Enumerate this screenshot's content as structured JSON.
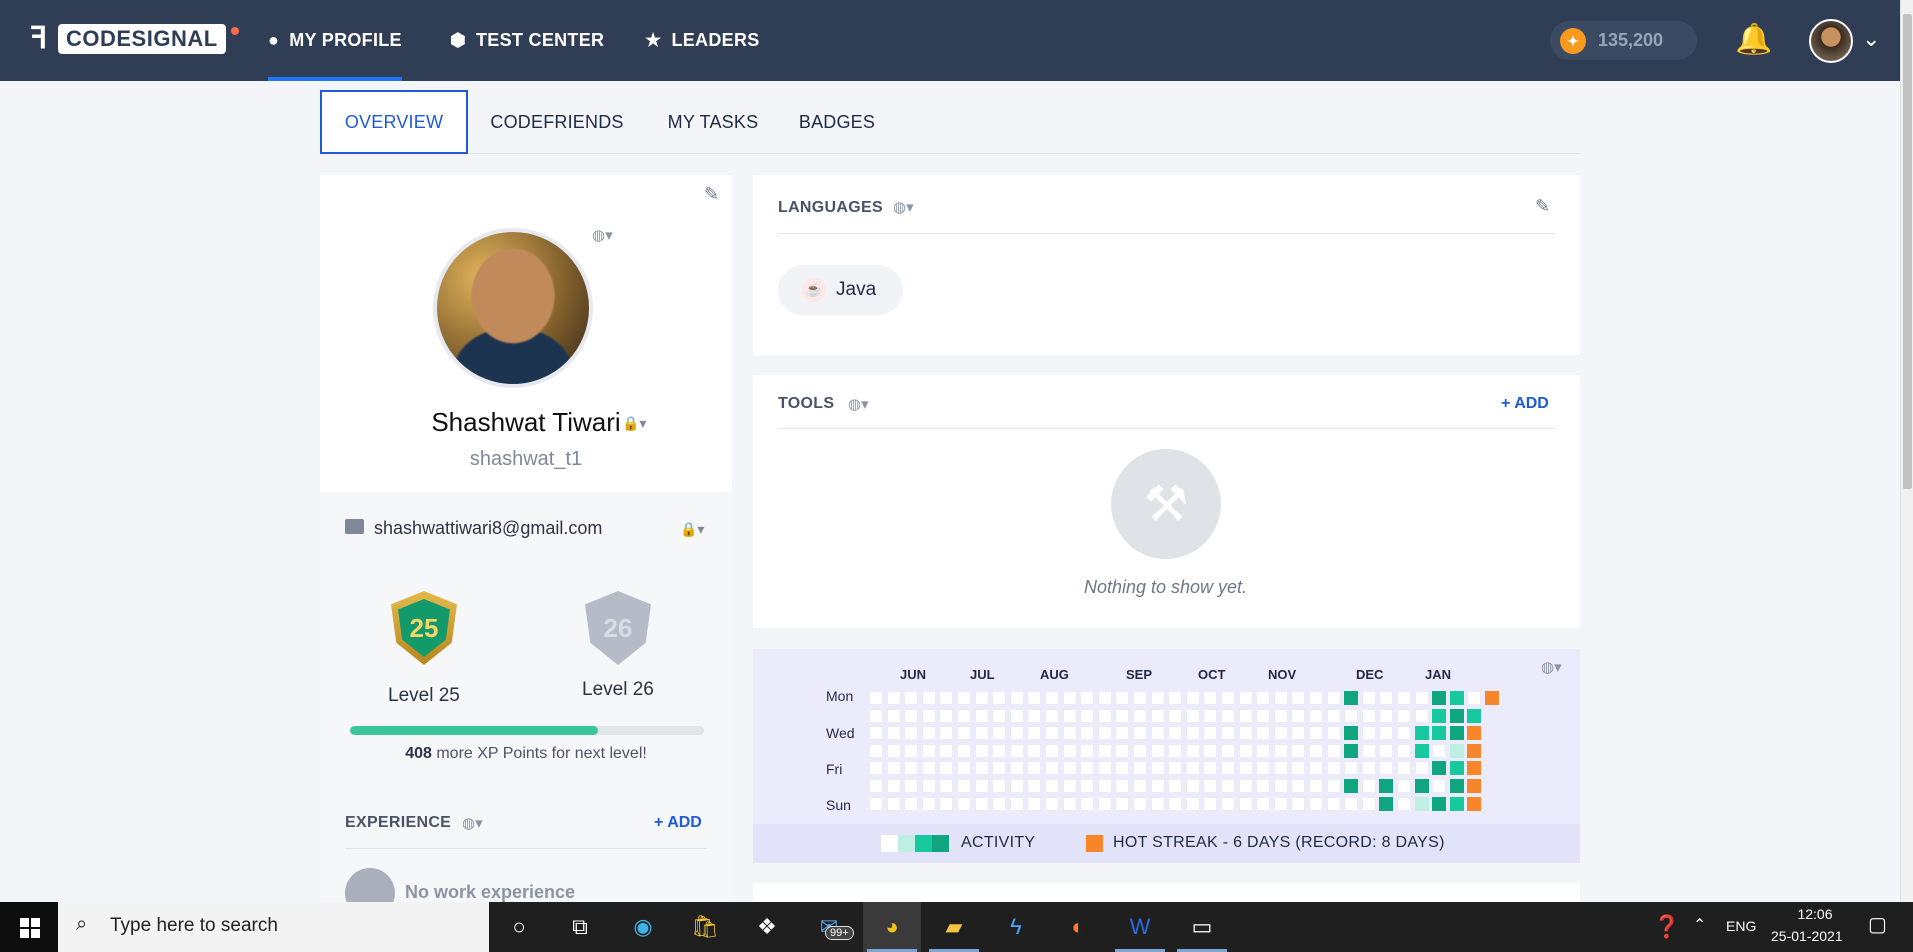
{
  "nav": {
    "brand": "CODESIGNAL",
    "items": [
      {
        "label": "MY PROFILE",
        "icon": "user-circle-icon",
        "active": true
      },
      {
        "label": "TEST CENTER",
        "icon": "shield-check-icon",
        "active": false
      },
      {
        "label": "LEADERS",
        "icon": "star-icon",
        "active": false
      }
    ],
    "coins": "135,200"
  },
  "tabs": [
    {
      "label": "OVERVIEW",
      "active": true
    },
    {
      "label": "CODEFRIENDS",
      "active": false
    },
    {
      "label": "MY TASKS",
      "active": false
    },
    {
      "label": "BADGES",
      "active": false
    }
  ],
  "profile": {
    "name": "Shashwat Tiwari",
    "username": "shashwat_t1",
    "email": "shashwattiwari8@gmail.com",
    "current_level": "25",
    "current_level_label": "Level 25",
    "next_level": "26",
    "next_level_label": "Level 26",
    "xp_progress_fraction": 0.7,
    "xp_needed": "408",
    "xp_text": "more XP Points for next level!"
  },
  "experience": {
    "title": "EXPERIENCE",
    "add": "+ ADD",
    "empty": "No work experience"
  },
  "languages": {
    "title": "LANGUAGES",
    "items": [
      "Java"
    ]
  },
  "tools": {
    "title": "TOOLS",
    "add": "+ ADD",
    "empty": "Nothing to show yet."
  },
  "activity": {
    "months": [
      "JUN",
      "JUL",
      "AUG",
      "SEP",
      "OCT",
      "NOV",
      "DEC",
      "JAN"
    ],
    "days": [
      "Mon",
      "Wed",
      "Fri",
      "Sun"
    ],
    "legend_activity": "ACTIVITY",
    "legend_streak": "HOT STREAK - 6 DAYS (RECORD: 8 DAYS)",
    "colors": {
      "empty": "#ffffff",
      "low": "#bfeee3",
      "mid": "#18c9a0",
      "high": "#0fa57e",
      "streak": "#f7862a"
    }
  },
  "taskbar": {
    "search_placeholder": "Type here to search",
    "mail_badge": "99+",
    "lang": "ENG",
    "time": "12:06",
    "date": "25-01-2021"
  }
}
